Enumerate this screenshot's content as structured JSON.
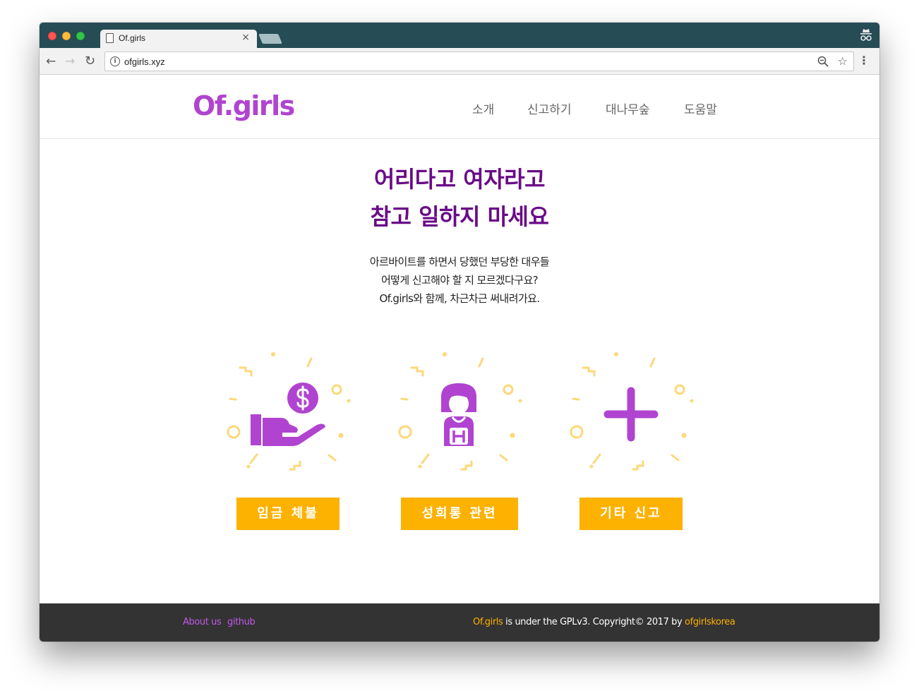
{
  "browser": {
    "tab_title": "Of.girls",
    "tab_close": "×",
    "url": "ofgirls.xyz",
    "back": "←",
    "forward": "→",
    "reload": "↻",
    "info": "i",
    "star": "☆",
    "menu": "⋮"
  },
  "site": {
    "logo": "Of.girls",
    "nav": [
      "소개",
      "신고하기",
      "대나무숲",
      "도움말"
    ]
  },
  "hero": {
    "title_line1": "어리다고 여자라고",
    "title_line2": "참고 일하지 마세요",
    "desc_line1": "아르바이트를 하면서 당했던 부당한 대우들",
    "desc_line2": "어떻게 신고해야 할 지 모르겠다구요?",
    "desc_line3": "Of.girls와 함께, 차근차근 써내려가요."
  },
  "cards": [
    {
      "icon": "hand-money-icon",
      "button": "임금 체불"
    },
    {
      "icon": "girl-worker-icon",
      "button": "성희롱 관련"
    },
    {
      "icon": "plus-icon",
      "button": "기타 신고"
    }
  ],
  "footer": {
    "about": "About us",
    "github": "github",
    "brand": "Of.girls",
    "license_text": " is under the GPLv3. Copyright© 2017 by ",
    "owner": "ofgirlskorea"
  },
  "colors": {
    "brand_purple": "#b044d0",
    "hero_purple": "#6a0b87",
    "accent_yellow": "#fdb100",
    "confetti": "#fdd87a",
    "footer_bg": "#333333",
    "titlebar_bg": "#264c55"
  }
}
